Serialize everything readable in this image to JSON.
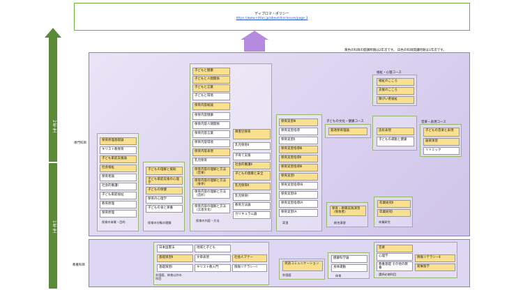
{
  "header": {
    "title": "ディプロマ・ポリシー",
    "url": "https://www.nittan.jp/about/disclosure/page-3"
  },
  "note": "黄色の科目の開講時期は2年次です。 白色の科目開講時期は1年次です。",
  "years": {
    "upper": "2年生",
    "lower": "1年生"
  },
  "row_labels": {
    "senmon": "専門科目",
    "kyoyo": "教養科目"
  },
  "colors": {
    "year2": "#f9e08e",
    "year1": "#ffffff",
    "arrow": "#5a8a35",
    "panel": "#ddd6f2"
  },
  "groups": {
    "g1": {
      "caption": "保育の本質・目的",
      "items": [
        "保育原理基礎論",
        "キリスト教保育",
        "子ども家庭支援論",
        "社会福祉",
        "保育者論",
        "社会的養護Ⅰ",
        "子ども家庭福祉",
        "教育原理",
        "保育原理"
      ]
    },
    "g2": {
      "caption": "保育の対象の理解",
      "items": [
        "子どもの理解と援助",
        "子ども家庭支援の心理学",
        "子どもの保健",
        "保育の心理学",
        "子どもの食と栄養",
        "保育の心理学"
      ]
    },
    "g3": {
      "caption": "保育の内容・方法",
      "items": [
        "子どもと健康",
        "子どもと人間関係",
        "子どもと言葉",
        "子どもと環境",
        "保育内容総論",
        "保育内容健康",
        "保育内容人間関係",
        "保育内容言葉",
        "保育内容環境",
        "保育内容表現",
        "乳児保育",
        "保育内容の理解と方法（音楽）",
        "保育内容の理解と方法（身体）",
        "保育内容の理解と方法（造形）",
        "保育内容の理解と方法（言語文化）"
      ]
    },
    "g3b": {
      "items": [
        "障害児保育",
        "乳児保育Ⅱ",
        "子育て支援",
        "社会的養護Ⅱ",
        "子どもの健康と安全",
        "乳児保育Ⅱ",
        "乳児保育Ⅰ",
        "教育方法論",
        "カリキュラム論"
      ]
    },
    "g4": {
      "caption": "実習",
      "items": [
        "保育実習Ⅲ",
        "保育実習指導",
        "保育実習Ⅱ",
        "保育実習指導Ⅲ",
        "保育実習指導Ⅱ",
        "保育実習指導Ⅲ",
        "保育実習Ⅰ",
        "保育実習指導ⅠB",
        "保育実習ⅠB",
        "保育実習指導ⅠA",
        "保育実習ⅠA"
      ]
    },
    "g5": {
      "title": "子どもの文化・健康コース",
      "items": [
        "発達保育理論"
      ]
    },
    "g5b": {
      "items": [
        "造形表現",
        "子どもの運動と健康"
      ]
    },
    "g6": {
      "title": "福祉・心理コース",
      "items": [
        "福祉のこころ",
        "支援のこころ",
        "障がい者福祉"
      ]
    },
    "g7": {
      "title": "音楽・表現コース",
      "items": [
        "子どもの音楽と表現",
        "器楽演習",
        "リトミック"
      ]
    },
    "g8": {
      "caption": "総合演習",
      "items": [
        "保育・教職実践演習（保育者）"
      ]
    },
    "g9": {
      "caption": "卒業研究",
      "items": [
        "卒業研究Ⅱ",
        "卒業研究Ⅰ"
      ]
    },
    "k1": {
      "caption": "外国語、体育以外の科目",
      "items": [
        "日本国憲法",
        "地域と子ども",
        "基礎演習Ⅱ",
        "文章表現",
        "社会人マナー",
        "基礎演習Ⅰ",
        "キリスト教入門",
        "情報リテラシーⅠ"
      ]
    },
    "k2": {
      "caption": "外国語",
      "items": [
        "英語コミュニケーション"
      ]
    },
    "k3": {
      "caption": "体育",
      "items": [
        "健康科学論",
        "身体運動"
      ]
    },
    "k4": {
      "caption": "選択必修科目",
      "items": [
        "音楽",
        "心理学",
        "情報リテラシーⅡ",
        "教養基礎 その他の教養",
        "発展留学"
      ]
    }
  }
}
